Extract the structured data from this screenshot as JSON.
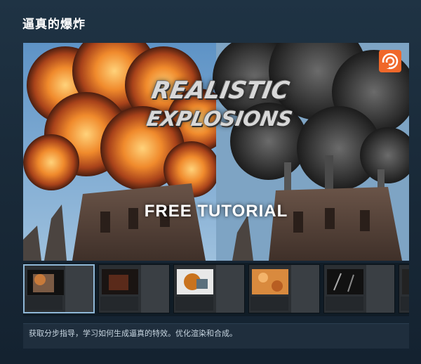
{
  "page": {
    "title": "逼真的爆炸"
  },
  "hero": {
    "title_line1": "REALISTIC",
    "title_line2": "EXPLOSIONS",
    "subtitle": "FREE TUTORIAL",
    "logo_icon": "houdini-logo-icon",
    "accent_color": "#f0682a"
  },
  "thumbnails": [
    {
      "label": "",
      "kind": "explosion-viewport",
      "active": true
    },
    {
      "label": "",
      "kind": "dark-fire-viewport",
      "active": false
    },
    {
      "label": "",
      "kind": "cloud-viewport",
      "active": false
    },
    {
      "label": "",
      "kind": "pyro-texture-viewport",
      "active": false
    },
    {
      "label": "",
      "kind": "smoke-particles-viewport",
      "active": false
    },
    {
      "label": "",
      "kind": "partial-viewport",
      "active": false
    }
  ],
  "description": {
    "text": "获取分步指导，学习如何生成逼真的特效。优化渲染和合成。"
  }
}
